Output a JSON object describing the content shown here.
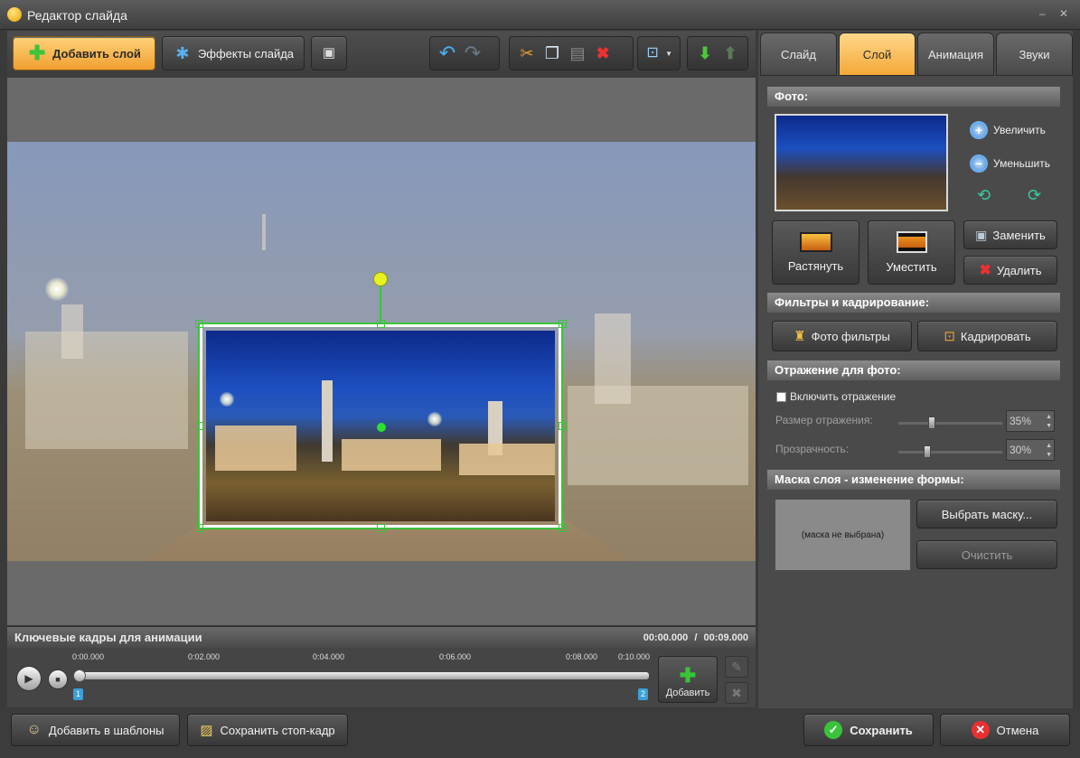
{
  "window": {
    "title": "Редактор слайда",
    "controls": {
      "minimize": "–",
      "close": "✕"
    }
  },
  "toolbar": {
    "add_layer": "Добавить слой",
    "slide_effects": "Эффекты слайда"
  },
  "keyframes": {
    "title": "Ключевые кадры для анимации",
    "current_time": "00:00.000",
    "separator": "/",
    "total_time": "00:09.000",
    "ruler": [
      "0:00.000",
      "0:02.000",
      "0:04.000",
      "0:06.000",
      "0:08.000",
      "0:10.000"
    ],
    "markers": [
      "1",
      "2"
    ],
    "add_label": "Добавить"
  },
  "tabs": [
    "Слайд",
    "Слой",
    "Анимация",
    "Звуки"
  ],
  "active_tab": "Слой",
  "photo": {
    "heading": "Фото:",
    "zoom_in": "Увеличить",
    "zoom_out": "Уменьшить",
    "stretch": "Растянуть",
    "fit": "Уместить",
    "replace": "Заменить",
    "delete": "Удалить"
  },
  "filters": {
    "heading": "Фильтры и кадрирование:",
    "photo_filters": "Фото фильтры",
    "crop": "Кадрировать"
  },
  "reflection": {
    "heading": "Отражение для фото:",
    "enable_label": "Включить отражение",
    "enabled": false,
    "size_label": "Размер отражения:",
    "size_value": "35%",
    "opacity_label": "Прозрачность:",
    "opacity_value": "30%"
  },
  "mask": {
    "heading": "Маска слоя - изменение формы:",
    "placeholder": "(маска не выбрана)",
    "choose": "Выбрать маску...",
    "clear": "Очистить"
  },
  "bottom": {
    "add_template": "Добавить в шаблоны",
    "save_frame": "Сохранить стоп-кадр",
    "save": "Сохранить",
    "cancel": "Отмена"
  },
  "colors": {
    "accent": "#f4a838",
    "selection": "#3ac43a",
    "rotate_knob": "#e8f020"
  }
}
